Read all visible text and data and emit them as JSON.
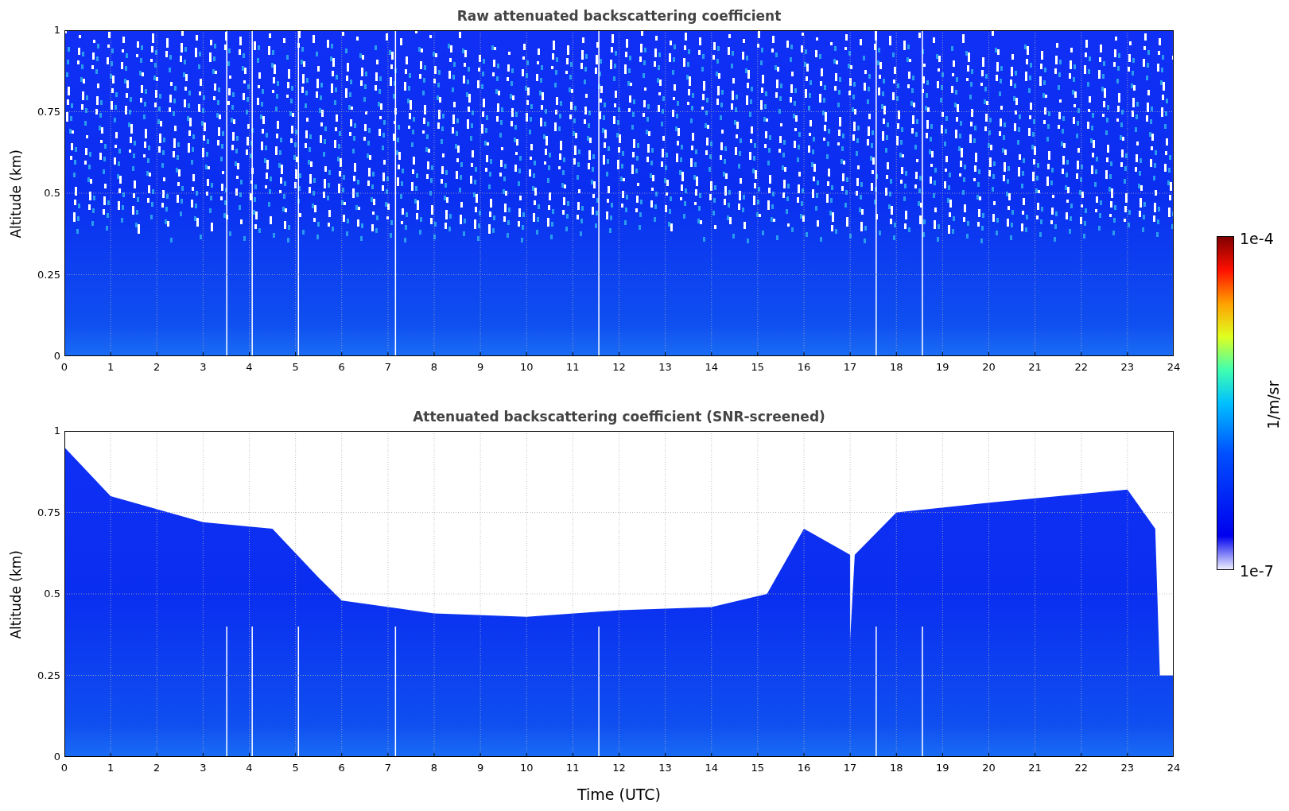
{
  "panels": [
    {
      "title": "Raw attenuated backscattering coefficient",
      "ylabel": "Altitude (km)",
      "screened": false,
      "yticks": [
        "1",
        "0.75",
        "0.5",
        "0.25",
        "0"
      ],
      "xticks": [
        "0",
        "1",
        "2",
        "3",
        "4",
        "5",
        "6",
        "7",
        "8",
        "9",
        "10",
        "11",
        "12",
        "13",
        "14",
        "15",
        "16",
        "17",
        "18",
        "19",
        "20",
        "21",
        "22",
        "23",
        "24"
      ]
    },
    {
      "title": "Attenuated backscattering coefficient (SNR-screened)",
      "ylabel": "Altitude (km)",
      "screened": true,
      "yticks": [
        "1",
        "0.75",
        "0.5",
        "0.25",
        "0"
      ],
      "xticks": [
        "0",
        "1",
        "2",
        "3",
        "4",
        "5",
        "6",
        "7",
        "8",
        "9",
        "10",
        "11",
        "12",
        "13",
        "14",
        "15",
        "16",
        "17",
        "18",
        "19",
        "20",
        "21",
        "22",
        "23",
        "24"
      ]
    }
  ],
  "xlabel": "Time (UTC)",
  "colorbar": {
    "max_label": "1e-4",
    "min_label": "1e-7",
    "unit": "1/m/sr"
  }
}
